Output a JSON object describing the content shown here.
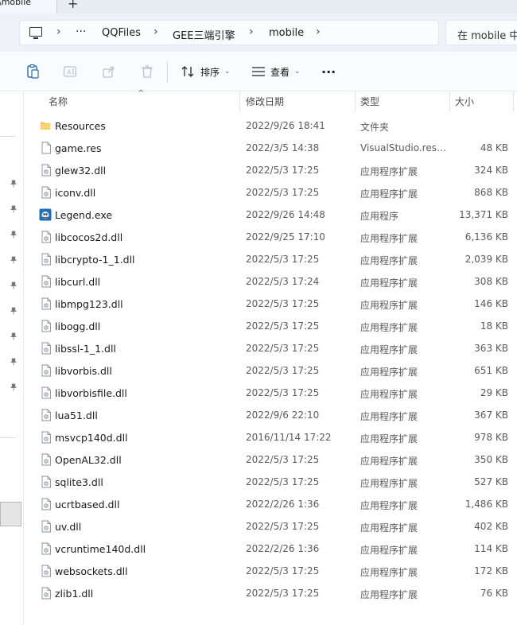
{
  "window": {
    "tab_title": "\\mobile"
  },
  "address": {
    "crumbs": [
      "QQFiles",
      "GEE三端引擎",
      "mobile"
    ],
    "search_placeholder": "在 mobile 中"
  },
  "toolbar": {
    "sort_label": "排序",
    "view_label": "查看",
    "more_label": "···"
  },
  "columns": {
    "name": "名称",
    "date": "修改日期",
    "type": "类型",
    "size": "大小"
  },
  "files": [
    {
      "name": "Resources",
      "date": "2022/9/26 18:41",
      "type": "文件夹",
      "size": "",
      "icon": "folder-icon"
    },
    {
      "name": "game.res",
      "date": "2022/3/5 14:38",
      "type": "VisualStudio.res....",
      "size": "48 KB",
      "icon": "file-icon"
    },
    {
      "name": "glew32.dll",
      "date": "2022/5/3 17:25",
      "type": "应用程序扩展",
      "size": "324 KB",
      "icon": "dll-icon"
    },
    {
      "name": "iconv.dll",
      "date": "2022/5/3 17:25",
      "type": "应用程序扩展",
      "size": "868 KB",
      "icon": "dll-icon"
    },
    {
      "name": "Legend.exe",
      "date": "2022/9/26 14:48",
      "type": "应用程序",
      "size": "13,371 KB",
      "icon": "app-icon"
    },
    {
      "name": "libcocos2d.dll",
      "date": "2022/9/25 17:10",
      "type": "应用程序扩展",
      "size": "6,136 KB",
      "icon": "dll-icon"
    },
    {
      "name": "libcrypto-1_1.dll",
      "date": "2022/5/3 17:25",
      "type": "应用程序扩展",
      "size": "2,039 KB",
      "icon": "dll-icon"
    },
    {
      "name": "libcurl.dll",
      "date": "2022/5/3 17:24",
      "type": "应用程序扩展",
      "size": "308 KB",
      "icon": "dll-icon"
    },
    {
      "name": "libmpg123.dll",
      "date": "2022/5/3 17:25",
      "type": "应用程序扩展",
      "size": "146 KB",
      "icon": "dll-icon"
    },
    {
      "name": "libogg.dll",
      "date": "2022/5/3 17:25",
      "type": "应用程序扩展",
      "size": "18 KB",
      "icon": "dll-icon"
    },
    {
      "name": "libssl-1_1.dll",
      "date": "2022/5/3 17:25",
      "type": "应用程序扩展",
      "size": "363 KB",
      "icon": "dll-icon"
    },
    {
      "name": "libvorbis.dll",
      "date": "2022/5/3 17:25",
      "type": "应用程序扩展",
      "size": "651 KB",
      "icon": "dll-icon"
    },
    {
      "name": "libvorbisfile.dll",
      "date": "2022/5/3 17:25",
      "type": "应用程序扩展",
      "size": "29 KB",
      "icon": "dll-icon"
    },
    {
      "name": "lua51.dll",
      "date": "2022/9/6 22:10",
      "type": "应用程序扩展",
      "size": "367 KB",
      "icon": "dll-icon"
    },
    {
      "name": "msvcp140d.dll",
      "date": "2016/11/14 17:22",
      "type": "应用程序扩展",
      "size": "978 KB",
      "icon": "dll-icon"
    },
    {
      "name": "OpenAL32.dll",
      "date": "2022/5/3 17:25",
      "type": "应用程序扩展",
      "size": "350 KB",
      "icon": "dll-icon"
    },
    {
      "name": "sqlite3.dll",
      "date": "2022/5/3 17:25",
      "type": "应用程序扩展",
      "size": "527 KB",
      "icon": "dll-icon"
    },
    {
      "name": "ucrtbased.dll",
      "date": "2022/2/26 1:36",
      "type": "应用程序扩展",
      "size": "1,486 KB",
      "icon": "dll-icon"
    },
    {
      "name": "uv.dll",
      "date": "2022/5/3 17:25",
      "type": "应用程序扩展",
      "size": "402 KB",
      "icon": "dll-icon"
    },
    {
      "name": "vcruntime140d.dll",
      "date": "2022/2/26 1:36",
      "type": "应用程序扩展",
      "size": "114 KB",
      "icon": "dll-icon"
    },
    {
      "name": "websockets.dll",
      "date": "2022/5/3 17:25",
      "type": "应用程序扩展",
      "size": "172 KB",
      "icon": "dll-icon"
    },
    {
      "name": "zlib1.dll",
      "date": "2022/5/3 17:25",
      "type": "应用程序扩展",
      "size": "76 KB",
      "icon": "dll-icon"
    }
  ],
  "colors": {
    "folder": "#f7c24a",
    "accent": "#0067c0",
    "toolbar_bg": "#f9fbfd",
    "address_bg": "#eef2f8"
  }
}
